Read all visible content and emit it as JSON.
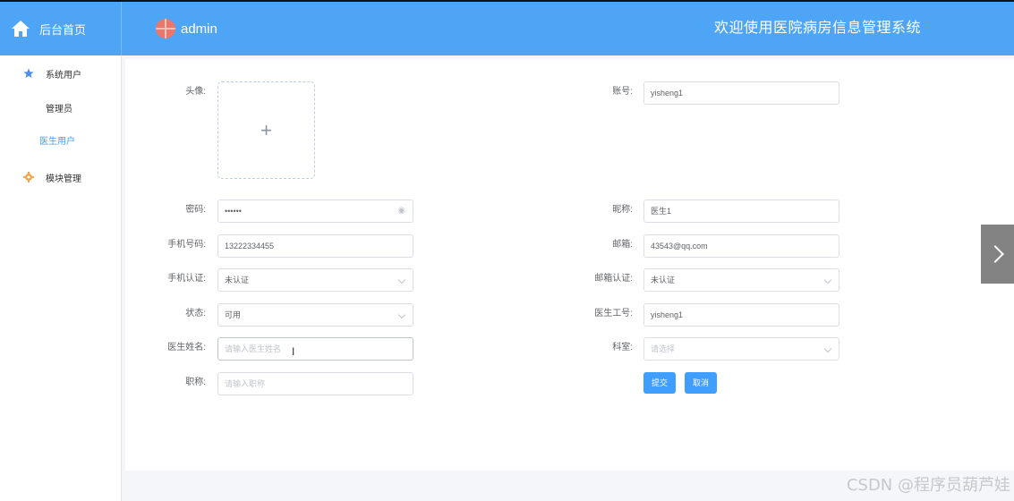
{
  "header": {
    "home_label": "后台首页",
    "user_name": "admin",
    "system_title": "欢迎使用医院病房信息管理系统"
  },
  "sidebar": {
    "menu1_label": "系统用户",
    "sub_admin": "管理员",
    "sub_doctor": "医生用户",
    "menu2_label": "模块管理"
  },
  "form": {
    "avatar_label": "头像:",
    "upload_plus": "+",
    "account_label": "账号:",
    "account_value": "yisheng1",
    "password_label": "密码:",
    "password_value": "••••••",
    "nickname_label": "昵称:",
    "nickname_value": "医生1",
    "phone_label": "手机号码:",
    "phone_value": "13222334455",
    "email_label": "邮箱:",
    "email_value": "43543@qq.com",
    "phone_verify_label": "手机认证:",
    "phone_verify_value": "未认证",
    "email_verify_label": "邮箱认证:",
    "email_verify_value": "未认证",
    "status_label": "状态:",
    "status_value": "可用",
    "doctor_no_label": "医生工号:",
    "doctor_no_value": "yisheng1",
    "doctor_name_label": "医生姓名:",
    "doctor_name_placeholder": "请输入医生姓名",
    "dept_label": "科室:",
    "dept_placeholder": "请选择",
    "title_label": "职称:",
    "title_placeholder": "请输入职称",
    "submit_label": "提交",
    "cancel_label": "取消"
  },
  "watermark": "CSDN @程序员葫芦娃",
  "colors": {
    "header": "#4ea4f5",
    "primary": "#409eff",
    "icon_star": "#4b91e8",
    "icon_gear": "#f0a84a"
  }
}
